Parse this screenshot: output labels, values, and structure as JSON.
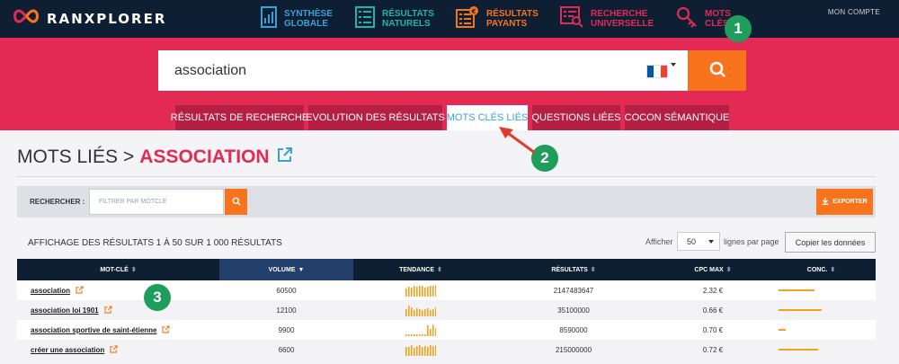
{
  "app": {
    "logo_text": "RANXPLORER"
  },
  "nav": {
    "items": [
      {
        "label_line1": "SYNTHÈSE",
        "label_line2": "GLOBALE",
        "color": "#3aa0d8",
        "icon": "chart-doc-icon"
      },
      {
        "label_line1": "RÉSULTATS",
        "label_line2": "NATURELS",
        "color": "#23b3a8",
        "icon": "list-doc-icon"
      },
      {
        "label_line1": "RÉSULTATS",
        "label_line2": "PAYANTS",
        "color": "#f7741c",
        "icon": "paid-list-icon"
      },
      {
        "label_line1": "RECHERCHE",
        "label_line2": "UNIVERSELLE",
        "color": "#e22a55",
        "icon": "universal-search-icon"
      },
      {
        "label_line1": "MOTS",
        "label_line2": "CLÉS",
        "color": "#e22a55",
        "icon": "key-icon"
      }
    ],
    "account_label": "MON COMPTE"
  },
  "search": {
    "value": "association",
    "flag_colors": [
      "#0055a4",
      "#ffffff",
      "#ef4135"
    ],
    "button_icon": "search-icon"
  },
  "tabs": [
    {
      "label": "RÉSULTATS DE RECHERCHE",
      "active": false
    },
    {
      "label": "EVOLUTION DES RÉSULTATS",
      "active": false
    },
    {
      "label": "MOTS CLÉS LIÉS",
      "active": true
    },
    {
      "label": "QUESTIONS LIÉES",
      "active": false
    },
    {
      "label": "COCON SÉMANTIQUE",
      "active": false
    }
  ],
  "page": {
    "title_prefix": "MOTS LIÉS",
    "title_sep": ">",
    "title_keyword": "ASSOCIATION"
  },
  "filter": {
    "label": "RECHERCHER :",
    "placeholder": "FILTRER PAR MOTCLE",
    "export_label": "EXPORTER"
  },
  "results": {
    "info": "AFFICHAGE DES RÉSULTATS 1 À 50 SUR 1 000 RÉSULTATS",
    "show_label": "Afficher",
    "rows_value": "50",
    "per_page_label": "lignes par page",
    "copy_label": "Copier les données"
  },
  "table": {
    "columns": [
      {
        "label": "MOT-CLÉ",
        "sorted": false
      },
      {
        "label": "VOLUME",
        "sorted": true
      },
      {
        "label": "TENDANCE",
        "sorted": false
      },
      {
        "label": "RÉSULTATS",
        "sorted": false
      },
      {
        "label": "CPC MAX",
        "sorted": false
      },
      {
        "label": "CONC.",
        "sorted": false
      }
    ],
    "rows": [
      {
        "keyword": "association",
        "volume": "60500",
        "trend": [
          0.7,
          0.85,
          0.8,
          0.9,
          0.85,
          0.95,
          0.9,
          0.8,
          0.85,
          0.95,
          0.9,
          1
        ],
        "results": "2147483647",
        "cpc": "2.32 €",
        "competition": 0.5
      },
      {
        "keyword": "association loi 1901",
        "volume": "12100",
        "trend": [
          0.6,
          0.9,
          0.8,
          0.55,
          0.7,
          0.6,
          0.5,
          0.65,
          0.7,
          0.55,
          0.6,
          0.75
        ],
        "results": "35100000",
        "cpc": "0.66 €",
        "competition": 0.6
      },
      {
        "keyword": "association sportive de saint-étienne",
        "volume": "9900",
        "trend": [
          0.15,
          0.15,
          0.15,
          0.15,
          0.15,
          0.15,
          0.15,
          0.15,
          0.9,
          0.6,
          1,
          0.7
        ],
        "results": "8590000",
        "cpc": "0.70 €",
        "competition": 0.1
      },
      {
        "keyword": "créer une association",
        "volume": "6600",
        "trend": [
          0.75,
          0.8,
          0.9,
          0.7,
          0.85,
          0.9,
          0.8,
          0.85,
          0.8,
          0.9,
          0.85,
          0.9
        ],
        "results": "215000000",
        "cpc": "0.72 €",
        "competition": 0.55
      }
    ]
  },
  "annotations": [
    "1",
    "2",
    "3"
  ],
  "colors": {
    "accent_pink": "#e22a55",
    "accent_orange": "#f7741c",
    "nav_dark": "#0f1f33",
    "badge_green": "#1f9d5c",
    "arrow_red": "#e23b2e"
  }
}
